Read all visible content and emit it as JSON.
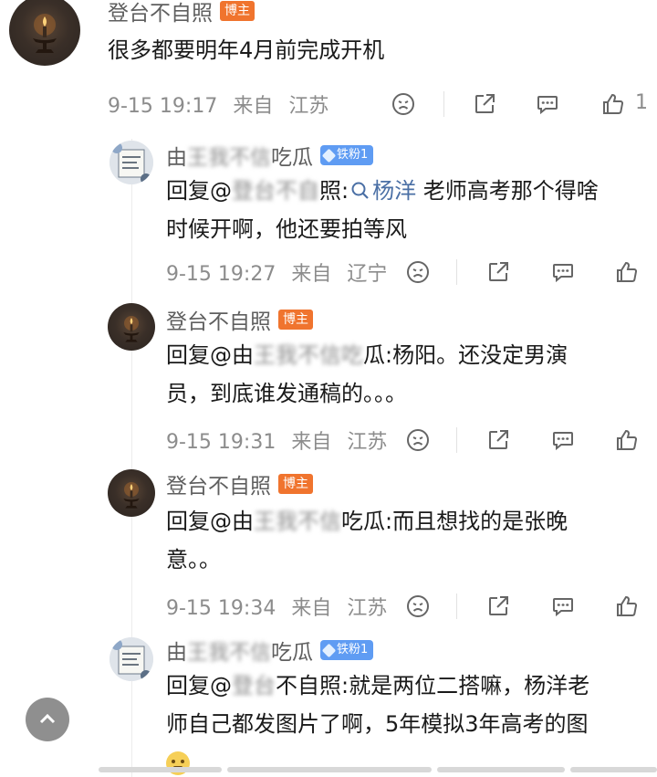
{
  "main_comment": {
    "username": "登台不自照",
    "badge": "博主",
    "text": "很多都要明年4月前完成开机",
    "time": "9-15 19:17",
    "from_label": "来自",
    "location": "江苏",
    "like_count": "1"
  },
  "replies": [
    {
      "username_visible_start": "由",
      "username_blurred": "王我不信",
      "username_visible_end": "吃瓜",
      "badge": "铁粉1",
      "reply_prefix": "回复",
      "mention_visible_start": "@",
      "mention_blurred": "登台不自",
      "mention_visible_end": "照:",
      "topic_icon": "search-icon",
      "topic": "杨洋",
      "text_line1_rest": " 老师高考那个得啥",
      "text_line2": "时候开啊，他还要拍等风",
      "time": "9-15 19:27",
      "from_label": "来自",
      "location": "辽宁"
    },
    {
      "username": "登台不自照",
      "badge": "博主",
      "reply_prefix": "回复",
      "mention_visible_start": "@由",
      "mention_blurred": "王我不信吃",
      "mention_visible_end": "瓜:",
      "text_line1_rest": "杨阳。还没定男演",
      "text_line2": "员，到底谁发通稿的。。。",
      "time": "9-15 19:31",
      "from_label": "来自",
      "location": "江苏"
    },
    {
      "username": "登台不自照",
      "badge": "博主",
      "reply_prefix": "回复",
      "mention_visible_start": "@由",
      "mention_blurred": "王我不信",
      "mention_visible_end": "吃瓜:",
      "text_line1_rest": "而且想找的是张晚",
      "text_line2": "意。。",
      "time": "9-15 19:34",
      "from_label": "来自",
      "location": "江苏"
    },
    {
      "username_visible_start": "由",
      "username_blurred": "王我不信",
      "username_visible_end": "吃瓜",
      "badge": "铁粉1",
      "reply_prefix": "回复",
      "mention_visible_start": "@",
      "mention_blurred": "登台",
      "mention_visible_end": "不自照:",
      "text_line1_rest": "就是两位二搭嘛，杨洋老",
      "text_line2": "师自己都发图片了啊，5年模拟3年高考的图",
      "emoji": "thinking-emoji"
    }
  ],
  "icons": {
    "dislike": "dislike-icon",
    "share": "share-icon",
    "comment": "comment-icon",
    "like": "like-icon",
    "scroll_top": "chevron-up-icon"
  },
  "colors": {
    "author_badge": "#f0742e",
    "fan_badge": "#5f9cf3",
    "topic_link": "#4a6fa5"
  }
}
